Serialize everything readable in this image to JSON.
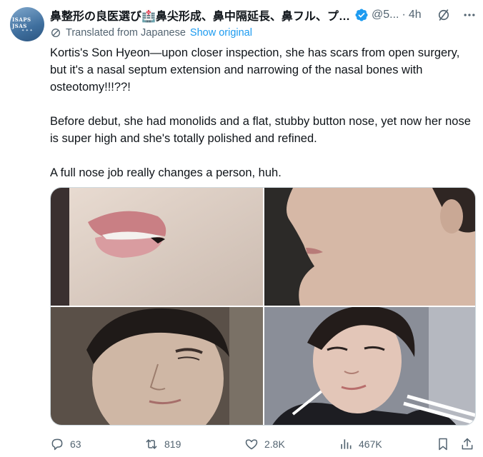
{
  "author": {
    "display_name": "鼻整形の良医選び🏥鼻尖形成、鼻中隔延長、鼻フル、プロテ...",
    "handle": "@5...",
    "separator": "·",
    "time": "4h",
    "avatar_text": "ISAPS\nJSAS",
    "verified_color": "#1d9bf0"
  },
  "translation": {
    "label": "Translated from Japanese",
    "show_original": "Show original"
  },
  "tweet": {
    "paragraphs": [
      "Kortis's Son Hyeon—upon closer inspection, she has scars from open surgery, but it's a nasal septum extension and narrowing of the nasal bones with osteotomy!!!??!",
      "Before debut, she had monolids and a flat, stubby button nose, yet now her nose is super high and she's totally polished and refined.",
      "A full nose job really changes a person, huh."
    ]
  },
  "media": {
    "images": [
      {
        "subject": "lips close-up"
      },
      {
        "subject": "nose and chin profile"
      },
      {
        "subject": "pre-debut portrait"
      },
      {
        "subject": "post-debut portrait"
      }
    ]
  },
  "actions": {
    "replies": "63",
    "retweets": "819",
    "likes": "2.8K",
    "views": "467K"
  },
  "icons": {
    "reply": "reply-icon",
    "retweet": "retweet-icon",
    "like": "heart-icon",
    "views": "views-icon",
    "bookmark": "bookmark-icon",
    "share": "share-icon",
    "grok": "grok-icon",
    "more": "more-icon",
    "translate": "translate-icon",
    "verified": "verified-badge-icon"
  },
  "colors": {
    "text": "#0f1419",
    "secondary": "#536471",
    "link": "#1d9bf0",
    "border": "#cfd9de"
  }
}
